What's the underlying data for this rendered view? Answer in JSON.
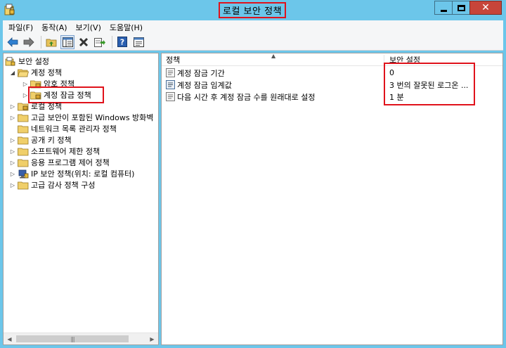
{
  "window": {
    "title": "로컬 보안 정책"
  },
  "menu": {
    "items": [
      "파일(F)",
      "동작(A)",
      "보기(V)",
      "도움말(H)"
    ]
  },
  "toolbar": {
    "buttons": [
      "back-icon",
      "forward-icon",
      "up-folder-icon",
      "show-hide-tree-icon",
      "delete-icon",
      "export-list-icon",
      "help-icon",
      "properties-icon"
    ]
  },
  "tree": {
    "root": "보안 설정",
    "items": [
      {
        "label": "계정 정책",
        "icon": "folder-icon"
      },
      {
        "label": "암호 정책",
        "icon": "folder-icon"
      },
      {
        "label": "계정 잠금 정책",
        "icon": "folder-icon",
        "selected": true
      },
      {
        "label": "로컬 정책",
        "icon": "folder-icon"
      },
      {
        "label": "고급 보안이 포함된 Windows 방화벽",
        "icon": "folder-icon"
      },
      {
        "label": "네트워크 목록 관리자 정책",
        "icon": "folder-icon"
      },
      {
        "label": "공개 키 정책",
        "icon": "folder-icon"
      },
      {
        "label": "소프트웨어 제한 정책",
        "icon": "folder-icon"
      },
      {
        "label": "응용 프로그램 제어 정책",
        "icon": "folder-icon"
      },
      {
        "label": "IP 보안 정책(위치: 로컬 컴퓨터)",
        "icon": "ip-security-icon"
      },
      {
        "label": "고급 감사 정책 구성",
        "icon": "folder-icon"
      }
    ]
  },
  "list": {
    "columns": [
      "정책",
      "보안 설정"
    ],
    "rows": [
      {
        "name": "계정 잠금 기간",
        "value": "0"
      },
      {
        "name": "계정 잠금 임계값",
        "value": "3 번의 잘못된 로그온 ..."
      },
      {
        "name": "다음 시간 후 계정 잠금 수를 원래대로 설정",
        "value": "1 분"
      }
    ]
  },
  "colors": {
    "window_frame": "#6cc6ea",
    "highlight_box": "#e0121b",
    "close_button": "#c7453a"
  }
}
